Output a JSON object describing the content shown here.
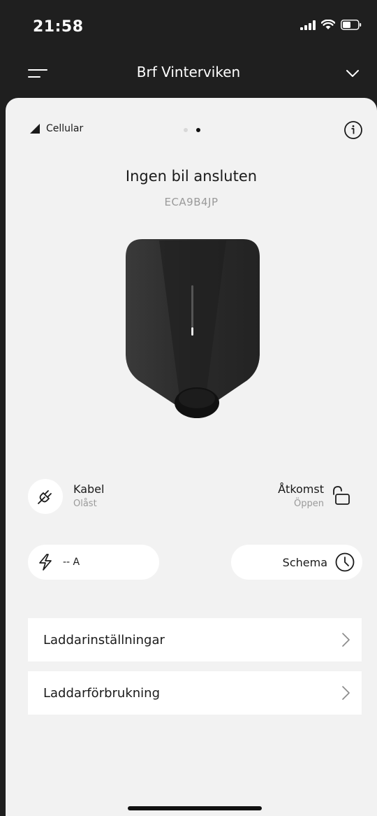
{
  "status_bar": {
    "time": "21:58"
  },
  "nav": {
    "title": "Brf Vinterviken"
  },
  "connection": {
    "label": "Cellular"
  },
  "pager": {
    "pages": 2,
    "active_index": 1
  },
  "charger": {
    "status_title": "Ingen bil ansluten",
    "serial": "ECA9B4JP"
  },
  "cable": {
    "label": "Kabel",
    "status": "Olåst"
  },
  "access": {
    "label": "Åtkomst",
    "status": "Öppen"
  },
  "current_pill": {
    "value": "-- A"
  },
  "schedule_pill": {
    "label": "Schema"
  },
  "menu": [
    {
      "label": "Laddarinställningar"
    },
    {
      "label": "Laddarförbrukning"
    }
  ],
  "colors": {
    "background_dark": "#1f1f1f",
    "sheet": "#f2f2f2",
    "card": "#ffffff",
    "secondary_text": "#9a9a9a",
    "charger_body": "#2b2b2b"
  },
  "icons": {
    "signal": "cellular-signal-icon",
    "wifi": "wifi-icon",
    "battery": "battery-icon",
    "menu": "hamburger-menu-icon",
    "dropdown": "chevron-down-icon",
    "info": "info-icon",
    "plug": "plug-icon",
    "unlock": "unlocked-padlock-icon",
    "bolt": "lightning-bolt-icon",
    "clock": "clock-icon",
    "chevron_right": "chevron-right-icon"
  }
}
